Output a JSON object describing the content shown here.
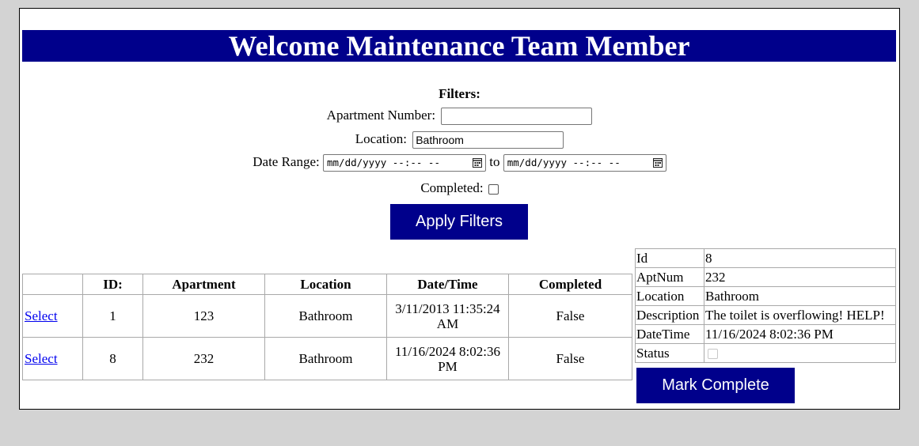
{
  "header": {
    "title": "Welcome Maintenance Team Member"
  },
  "filters": {
    "heading": "Filters:",
    "apartment_label": "Apartment Number:",
    "apartment_value": "",
    "location_label": "Location:",
    "location_value": "Bathroom",
    "date_label": "Date Range:",
    "date_from_placeholder": "mm/dd/yyyy --:-- --",
    "date_to_placeholder": "mm/dd/yyyy --:-- --",
    "date_sep": "to",
    "completed_label": "Completed:",
    "completed_checked": false,
    "apply_label": "Apply Filters"
  },
  "table": {
    "columns": [
      "",
      "ID:",
      "Apartment",
      "Location",
      "Date/Time",
      "Completed"
    ],
    "rows": [
      {
        "select": "Select",
        "id": "1",
        "apartment": "123",
        "location": "Bathroom",
        "datetime": "3/11/2013 11:35:24 AM",
        "completed": "False"
      },
      {
        "select": "Select",
        "id": "8",
        "apartment": "232",
        "location": "Bathroom",
        "datetime": "11/16/2024 8:02:36 PM",
        "completed": "False"
      }
    ]
  },
  "detail": {
    "labels": {
      "id": "Id",
      "apt": "AptNum",
      "location": "Location",
      "description": "Description",
      "datetime": "DateTime",
      "status": "Status"
    },
    "values": {
      "id": "8",
      "apt": "232",
      "location": "Bathroom",
      "description": "The toilet is overflowing! HELP!",
      "datetime": "11/16/2024 8:02:36 PM",
      "status_checked": false
    },
    "mark_complete_label": "Mark Complete"
  },
  "colors": {
    "accent": "#00008b",
    "background": "#d3d3d3",
    "link": "#0000ee"
  }
}
